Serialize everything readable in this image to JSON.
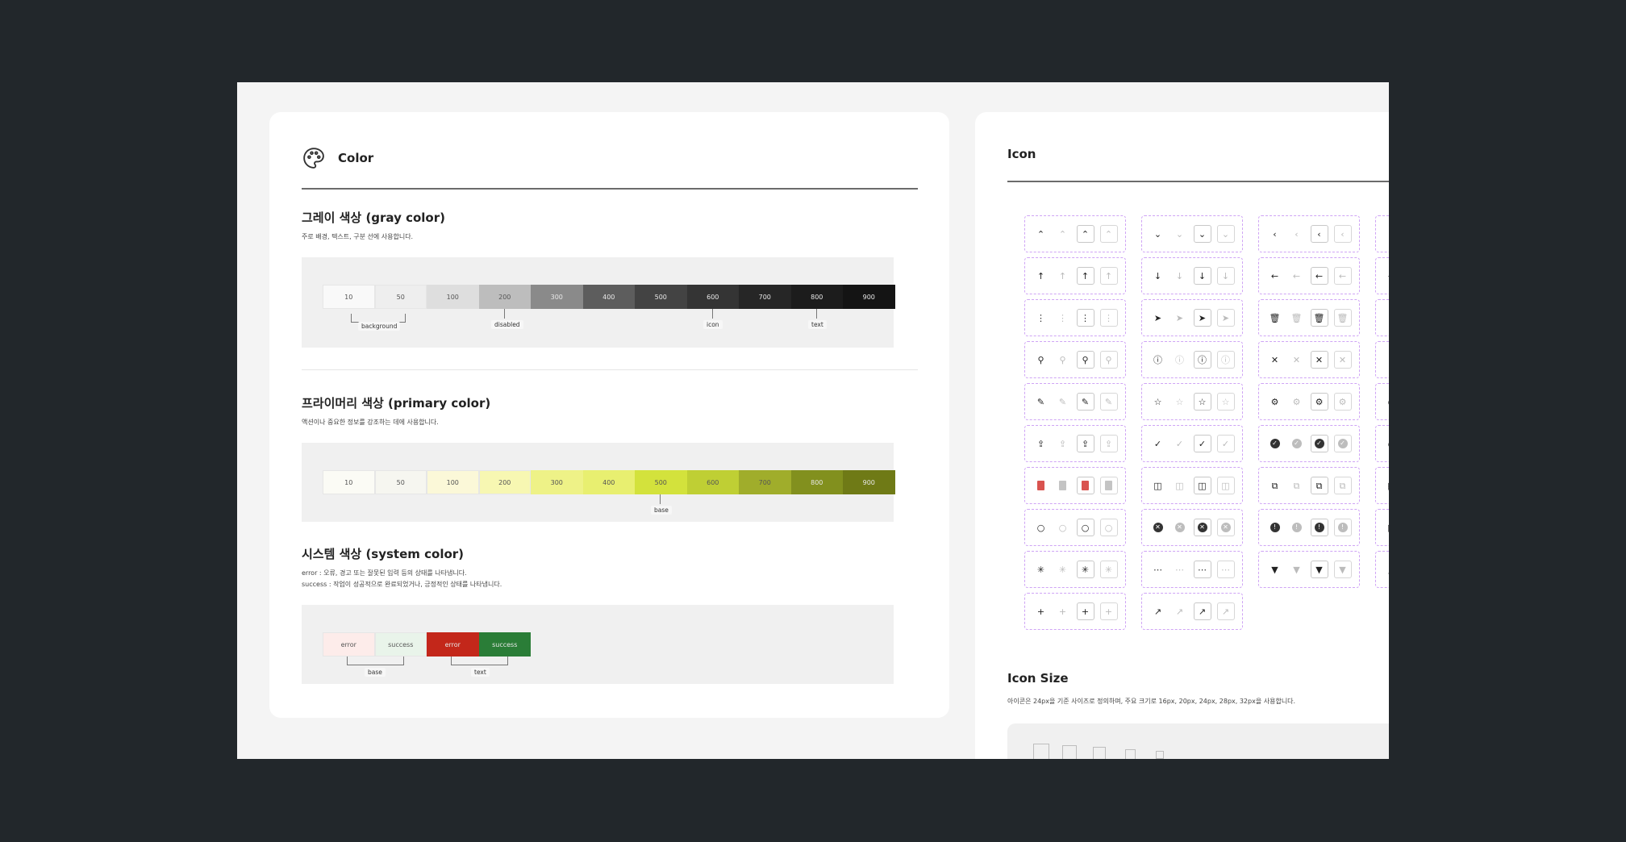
{
  "color_card": {
    "title": "Color",
    "gray": {
      "title": "그레이 색상 (gray color)",
      "desc": "주로 배경, 텍스트, 구분 선에 사용합니다.",
      "labels": [
        "10",
        "50",
        "100",
        "200",
        "300",
        "400",
        "500",
        "600",
        "700",
        "800",
        "900"
      ],
      "colors": [
        "#f9f9f9",
        "#eeeeee",
        "#dedede",
        "#bdbdbd",
        "#8a8a8a",
        "#5d5d5d",
        "#434343",
        "#343434",
        "#262626",
        "#1c1c1c",
        "#141414"
      ],
      "annotations": {
        "background": "background",
        "disabled": "disabled",
        "icon": "icon",
        "text": "text"
      }
    },
    "primary": {
      "title": "프라이머리 색상 (primary color)",
      "desc": "액션이나 중요한 정보를 강조하는 데에 사용합니다.",
      "labels": [
        "10",
        "50",
        "100",
        "200",
        "300",
        "400",
        "500",
        "600",
        "700",
        "800",
        "900"
      ],
      "colors": [
        "#fbfbf5",
        "#f6f6f0",
        "#fbf8d8",
        "#f7f7b2",
        "#eef287",
        "#e8ef70",
        "#d3e23c",
        "#bfcf34",
        "#a0ad2b",
        "#82901e",
        "#6f7a16"
      ],
      "annotations": {
        "base": "base"
      }
    },
    "system": {
      "title": "시스템 색상 (system color)",
      "desc_error": "error : 오류, 경고 또는 잘못된 입력 등의 상태를 나타냅니다.",
      "desc_success": "success : 작업이 성공적으로 완료되었거나, 긍정적인 상태를 나타냅니다.",
      "labels": [
        "error",
        "success",
        "error",
        "success"
      ],
      "colors": [
        "#fdecea",
        "#e9f4ea",
        "#c3271a",
        "#2a7d37"
      ],
      "annotations": {
        "base": "base",
        "text": "text"
      }
    }
  },
  "icon_card": {
    "title": "Icon",
    "columns": [
      [
        "chevron-up-icon",
        "arrow-up-icon",
        "more-vertical-icon",
        "search-icon",
        "pencil-icon",
        "upload-icon",
        "pdf-file-icon",
        "radio-empty-icon",
        "asterisk-icon",
        "plus-icon"
      ],
      [
        "chevron-down-icon",
        "arrow-down-icon",
        "send-icon",
        "info-icon",
        "star-icon",
        "check-icon",
        "sidebar-icon",
        "x-circle-icon",
        "more-horizontal-icon",
        "external-arrow-icon"
      ],
      [
        "chevron-left-icon",
        "arrow-left-icon",
        "trash-icon",
        "close-icon",
        "settings-icon",
        "check-circle-icon",
        "copy-icon",
        "alert-circle-icon",
        "caret-down-icon"
      ],
      [
        "chevron-right-icon",
        "arrow-right-icon",
        "download-icon",
        "home-icon",
        "user-icon",
        "bell-icon",
        "calendar-icon",
        "lock-icon",
        "caret-up-icon"
      ]
    ],
    "size": {
      "title": "Icon Size",
      "desc": "아이콘은 24px을 기준 사이즈로 정의하며, 주요 크기로 16px, 20px, 24px, 28px, 32px을 사용합니다."
    }
  }
}
